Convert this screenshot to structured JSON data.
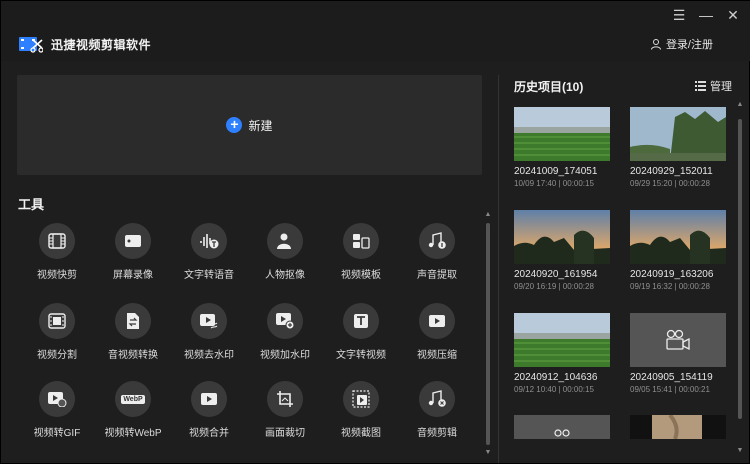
{
  "app": {
    "title": "迅捷视频剪辑软件",
    "login_label": "登录/注册"
  },
  "window_controls": {
    "menu": "☰",
    "minimize": "—",
    "close": "✕"
  },
  "new_project": {
    "label": "新建"
  },
  "tools": {
    "title": "工具",
    "items": [
      {
        "label": "视频快剪",
        "icon": "film-icon"
      },
      {
        "label": "屏幕录像",
        "icon": "screen-record-icon"
      },
      {
        "label": "文字转语音",
        "icon": "text-to-speech-icon"
      },
      {
        "label": "人物抠像",
        "icon": "portrait-cutout-icon"
      },
      {
        "label": "视频模板",
        "icon": "template-icon"
      },
      {
        "label": "声音提取",
        "icon": "audio-extract-icon"
      },
      {
        "label": "视频分割",
        "icon": "video-split-icon"
      },
      {
        "label": "音视频转换",
        "icon": "convert-icon"
      },
      {
        "label": "视频去水印",
        "icon": "remove-watermark-icon"
      },
      {
        "label": "视频加水印",
        "icon": "add-watermark-icon"
      },
      {
        "label": "文字转视频",
        "icon": "text-to-video-icon"
      },
      {
        "label": "视频压缩",
        "icon": "compress-icon"
      },
      {
        "label": "视频转GIF",
        "icon": "gif-icon"
      },
      {
        "label": "视频转WebP",
        "icon": "webp-icon"
      },
      {
        "label": "视频合并",
        "icon": "merge-icon"
      },
      {
        "label": "画面裁切",
        "icon": "crop-icon"
      },
      {
        "label": "视频截图",
        "icon": "screenshot-icon"
      },
      {
        "label": "音频剪辑",
        "icon": "audio-edit-icon"
      }
    ],
    "webp_badge": "WebP"
  },
  "history": {
    "title": "历史项目(10)",
    "manage_label": "管理",
    "items": [
      {
        "name": "20241009_174051",
        "meta": "10/09 17:40 | 00:00:15",
        "thumb": "field"
      },
      {
        "name": "20240929_152011",
        "meta": "09/29 15:20 | 00:00:28",
        "thumb": "trees"
      },
      {
        "name": "20240920_161954",
        "meta": "09/20 16:19 | 00:00:28",
        "thumb": "sunset"
      },
      {
        "name": "20240919_163206",
        "meta": "09/19 16:32 | 00:00:28",
        "thumb": "sunset"
      },
      {
        "name": "20240912_104636",
        "meta": "09/12 10:40 | 00:00:15",
        "thumb": "field"
      },
      {
        "name": "20240905_154119",
        "meta": "09/05 15:41 | 00:00:21",
        "thumb": "placeholder"
      }
    ]
  },
  "colors": {
    "accent": "#2f80ff",
    "bg": "#1e1e1e",
    "panel": "#2b2b2b",
    "icon_bg": "#3a3a3a"
  }
}
